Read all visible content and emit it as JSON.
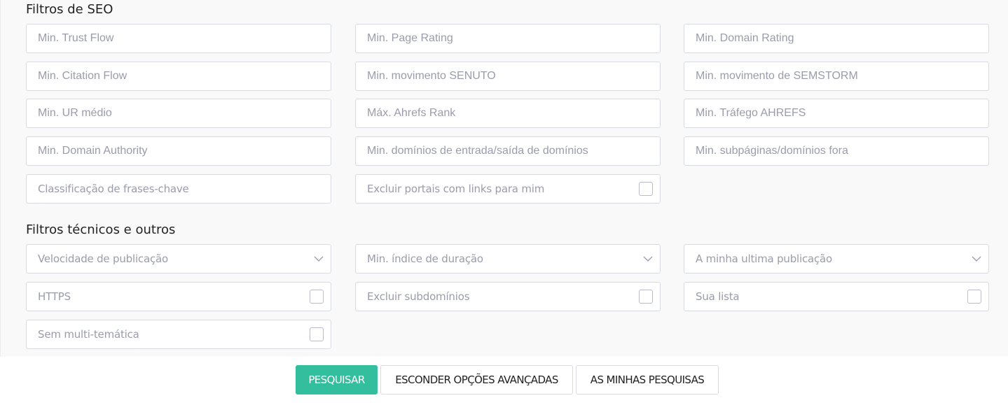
{
  "seo": {
    "title": "Filtros de SEO",
    "fields": [
      {
        "placeholder": "Min. Trust Flow",
        "type": "text"
      },
      {
        "placeholder": "Min. Page Rating",
        "type": "text"
      },
      {
        "placeholder": "Min. Domain Rating",
        "type": "text"
      },
      {
        "placeholder": "Min. Citation Flow",
        "type": "text"
      },
      {
        "placeholder": "Min. movimento SENUTO",
        "type": "text"
      },
      {
        "placeholder": "Min. movimento de SEMSTORM",
        "type": "text"
      },
      {
        "placeholder": "Min. UR médio",
        "type": "text"
      },
      {
        "placeholder": "Máx. Ahrefs Rank",
        "type": "text"
      },
      {
        "placeholder": "Min. Tráfego AHREFS",
        "type": "text"
      },
      {
        "placeholder": "Min. Domain Authority",
        "type": "text"
      },
      {
        "placeholder": "Min. domínios de entrada/saída de domínios",
        "type": "text"
      },
      {
        "placeholder": "Min. subpáginas/domínios fora",
        "type": "text"
      },
      {
        "placeholder": "Classificação de frases-chave",
        "type": "text"
      },
      {
        "placeholder": "Excluir portais com links para mim",
        "type": "checkbox",
        "checked": false
      }
    ]
  },
  "technical": {
    "title": "Filtros técnicos e outros",
    "fields": [
      {
        "placeholder": "Velocidade de publicação",
        "type": "select"
      },
      {
        "placeholder": "Min. índice de duração",
        "type": "select"
      },
      {
        "placeholder": "A minha ultima publicação",
        "type": "select"
      },
      {
        "placeholder": "HTTPS",
        "type": "checkbox",
        "checked": false
      },
      {
        "placeholder": "Excluir subdomínios",
        "type": "checkbox",
        "checked": false
      },
      {
        "placeholder": "Sua lista",
        "type": "checkbox",
        "checked": false
      },
      {
        "placeholder": "Sem multi-temática",
        "type": "checkbox",
        "checked": false
      }
    ]
  },
  "buttons": {
    "search": "PESQUISAR",
    "hide_advanced": "ESCONDER OPÇÕES AVANÇADAS",
    "my_searches": "AS MINHAS PESQUISAS"
  },
  "colors": {
    "primary": "#33be9d"
  }
}
